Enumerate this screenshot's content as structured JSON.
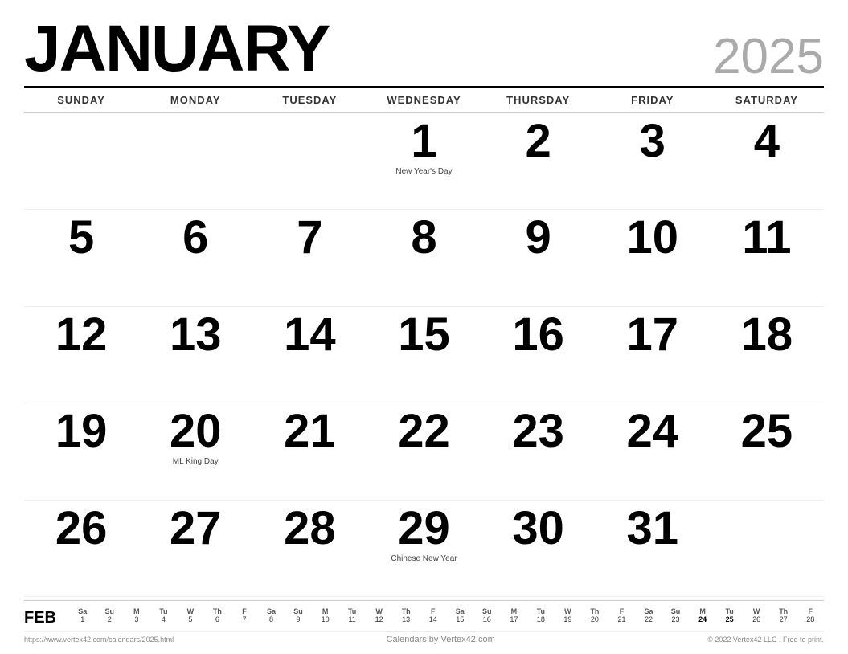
{
  "header": {
    "month": "JANUARY",
    "year": "2025"
  },
  "dayHeaders": [
    "SUNDAY",
    "MONDAY",
    "TUESDAY",
    "WEDNESDAY",
    "THURSDAY",
    "FRIDAY",
    "SATURDAY"
  ],
  "weeks": [
    [
      {
        "num": "",
        "holiday": ""
      },
      {
        "num": "",
        "holiday": ""
      },
      {
        "num": "",
        "holiday": ""
      },
      {
        "num": "1",
        "holiday": "New Year's Day"
      },
      {
        "num": "2",
        "holiday": ""
      },
      {
        "num": "3",
        "holiday": ""
      },
      {
        "num": "4",
        "holiday": ""
      }
    ],
    [
      {
        "num": "5",
        "holiday": ""
      },
      {
        "num": "6",
        "holiday": ""
      },
      {
        "num": "7",
        "holiday": ""
      },
      {
        "num": "8",
        "holiday": ""
      },
      {
        "num": "9",
        "holiday": ""
      },
      {
        "num": "10",
        "holiday": ""
      },
      {
        "num": "11",
        "holiday": ""
      }
    ],
    [
      {
        "num": "12",
        "holiday": ""
      },
      {
        "num": "13",
        "holiday": ""
      },
      {
        "num": "14",
        "holiday": ""
      },
      {
        "num": "15",
        "holiday": ""
      },
      {
        "num": "16",
        "holiday": ""
      },
      {
        "num": "17",
        "holiday": ""
      },
      {
        "num": "18",
        "holiday": ""
      }
    ],
    [
      {
        "num": "19",
        "holiday": ""
      },
      {
        "num": "20",
        "holiday": "ML King Day"
      },
      {
        "num": "21",
        "holiday": ""
      },
      {
        "num": "22",
        "holiday": ""
      },
      {
        "num": "23",
        "holiday": ""
      },
      {
        "num": "24",
        "holiday": ""
      },
      {
        "num": "25",
        "holiday": ""
      }
    ],
    [
      {
        "num": "26",
        "holiday": ""
      },
      {
        "num": "27",
        "holiday": ""
      },
      {
        "num": "28",
        "holiday": ""
      },
      {
        "num": "29",
        "holiday": "Chinese New Year"
      },
      {
        "num": "30",
        "holiday": ""
      },
      {
        "num": "31",
        "holiday": ""
      },
      {
        "num": "",
        "holiday": ""
      }
    ]
  ],
  "miniCalendar": {
    "label": "FEB",
    "headers": [
      "Sa",
      "Su",
      "M",
      "Tu",
      "W",
      "Th",
      "F",
      "Sa",
      "Su",
      "M",
      "Tu",
      "W",
      "Th",
      "F",
      "Sa",
      "Su",
      "M",
      "Tu",
      "W",
      "Th",
      "F",
      "Sa",
      "Su",
      "M",
      "Tu",
      "W",
      "Th",
      "F"
    ],
    "days": [
      "1",
      "2",
      "3",
      "4",
      "5",
      "6",
      "7",
      "8",
      "9",
      "10",
      "11",
      "12",
      "13",
      "14",
      "15",
      "16",
      "17",
      "18",
      "19",
      "20",
      "21",
      "22",
      "23",
      "24",
      "25",
      "26",
      "27",
      "28"
    ],
    "boldDays": [
      "24",
      "25"
    ]
  },
  "footer": {
    "left": "https://www.vertex42.com/calendars/2025.html",
    "center": "Calendars by Vertex42.com",
    "right": "© 2022 Vertex42 LLC . Free to print."
  }
}
